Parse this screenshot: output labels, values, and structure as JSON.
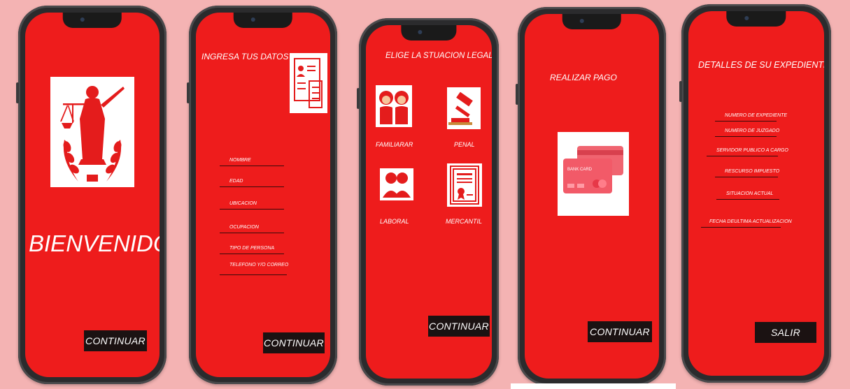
{
  "screens": {
    "welcome": {
      "title": "BIENVENIDO",
      "button": "CONTINUAR"
    },
    "data_entry": {
      "title": "INGRESA TUS DATOS",
      "fields": [
        "NOMBRE",
        "EDAD",
        "UBICACION",
        "OCUPACION",
        "TIPO DE PERSONA",
        "TELEFONO Y/O CORREO"
      ],
      "button": "CONTINUAR"
    },
    "legal_situation": {
      "title": "ELIGE LA STUACION LEGAL",
      "options": [
        "FAMILIARAR",
        "PENAL",
        "LABORAL",
        "MERCANTIL"
      ],
      "button": "CONTINUAR"
    },
    "payment": {
      "title": "REALIZAR PAGO",
      "card_text": "BANK CARD",
      "button": "CONTINUAR"
    },
    "details": {
      "title": "DETALLES DE SU EXPEDIENTE",
      "fields": [
        "NUMERO DE EXPEDIENTE",
        "NUMERO DE JUZGADO",
        "SERVIDOR PUBLICO A CARGO",
        "RESCURSO IMPUESTO",
        "SITUACION ACTUAL",
        "FECHA DEULTIMA ACTUALIZACION"
      ],
      "button": "SALIR"
    }
  },
  "colors": {
    "background": "#f4b3b3",
    "screen": "#ee1c1c",
    "button": "#1b1212",
    "phone": "#2b2b2d"
  },
  "icons": [
    "justice-statue-icon",
    "id-document-icon",
    "family-couple-icon",
    "gavel-icon",
    "workers-icon",
    "certificate-icon",
    "bank-card-icon"
  ]
}
